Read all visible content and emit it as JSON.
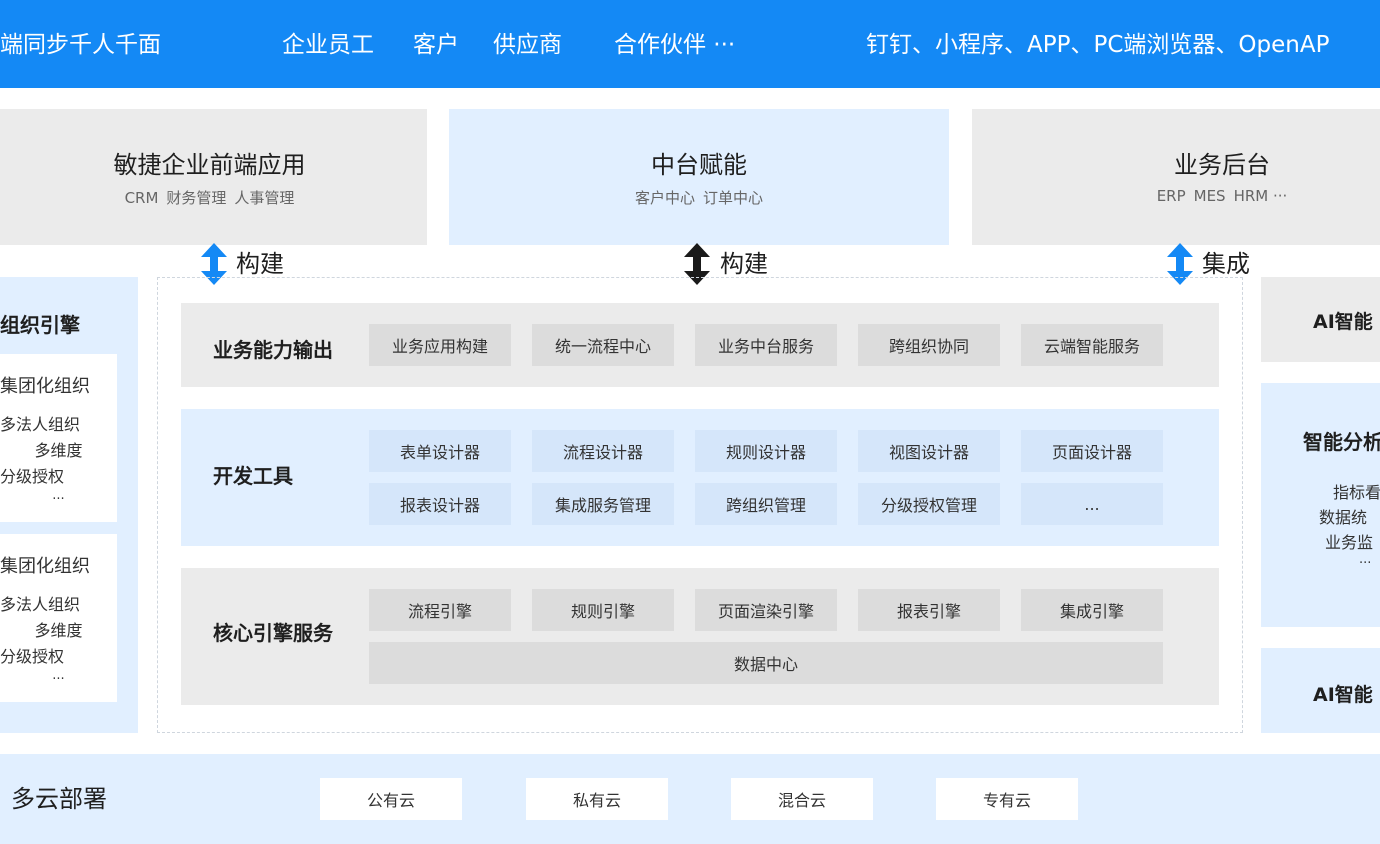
{
  "colors": {
    "brand_blue": "#1489f5",
    "light_blue": "#e1efff",
    "light_gray": "#ebebeb",
    "arrow_black": "#1a1a1a"
  },
  "top_banner": {
    "left_text": "端同步千人千面",
    "roles": [
      "企业员工",
      "客户",
      "供应商",
      "合作伙伴 ···"
    ],
    "channels": "钉钉、小程序、APP、PC端浏览器、OpenAP"
  },
  "upper_blocks": [
    {
      "title": "敏捷企业前端应用",
      "items": [
        "CRM",
        "财务管理",
        "人事管理"
      ]
    },
    {
      "title": "中台赋能",
      "items": [
        "客户中心",
        "订单中心"
      ]
    },
    {
      "title": "业务后台",
      "items": [
        "ERP",
        "MES",
        "HRM ···"
      ]
    }
  ],
  "arrows": [
    {
      "label": "构建",
      "icon": "double-arrow-blue-icon"
    },
    {
      "label": "构建",
      "icon": "double-arrow-black-icon"
    },
    {
      "label": "集成",
      "icon": "double-arrow-blue-icon"
    }
  ],
  "left_panel": {
    "title": "组织引擎",
    "cards": [
      {
        "lines": [
          "集团化组织",
          "多法人组织",
          "多维度",
          "分级授权",
          "..."
        ]
      },
      {
        "lines": [
          "集团化组织",
          "多法人组织",
          "多维度",
          "分级授权",
          "..."
        ]
      }
    ]
  },
  "sections": {
    "business_output": {
      "title": "业务能力输出",
      "items": [
        "业务应用构建",
        "统一流程中心",
        "业务中台服务",
        "跨组织协同",
        "云端智能服务"
      ]
    },
    "dev_tools": {
      "title": "开发工具",
      "row1": [
        "表单设计器",
        "流程设计器",
        "规则设计器",
        "视图设计器",
        "页面设计器"
      ],
      "row2": [
        "报表设计器",
        "集成服务管理",
        "跨组织管理",
        "分级授权管理",
        "..."
      ]
    },
    "core_engine": {
      "title": "核心引擎服务",
      "items": [
        "流程引擎",
        "规则引擎",
        "页面渲染引擎",
        "报表引擎",
        "集成引擎"
      ],
      "data_center": "数据中心"
    }
  },
  "right_panel": {
    "top_title": "AI智能",
    "analysis_title": "智能分析",
    "analysis_items": [
      "指标看",
      "数据统",
      "业务监",
      "..."
    ],
    "bottom_title": "AI智能"
  },
  "deployment": {
    "title": "多云部署",
    "options": [
      "公有云",
      "私有云",
      "混合云",
      "专有云"
    ]
  }
}
